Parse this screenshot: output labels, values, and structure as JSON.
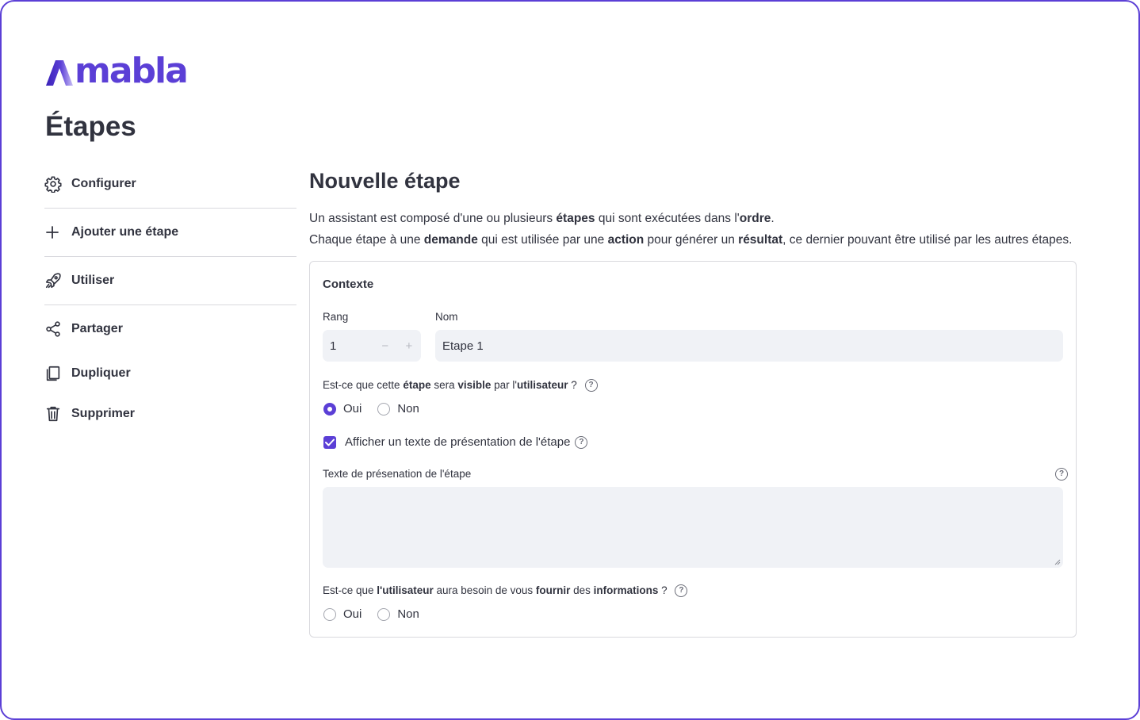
{
  "brand": {
    "name": "mabla",
    "color": "#5b3fd6"
  },
  "page": {
    "title": "Étapes"
  },
  "sidebar": {
    "items": [
      {
        "label": "Configurer",
        "icon": "gear-icon"
      },
      {
        "label": "Ajouter une étape",
        "icon": "plus-icon"
      },
      {
        "label": "Utiliser",
        "icon": "rocket-icon"
      },
      {
        "label": "Partager",
        "icon": "share-icon"
      },
      {
        "label": "Dupliquer",
        "icon": "copy-icon"
      },
      {
        "label": "Supprimer",
        "icon": "trash-icon"
      }
    ]
  },
  "main": {
    "title": "Nouvelle étape",
    "intro": {
      "line1": [
        "Un assistant est composé d'une ou plusieurs ",
        "étapes",
        " qui sont exécutées dans l'",
        "ordre",
        "."
      ],
      "line2": [
        "Chaque étape à une ",
        "demande",
        " qui est utilisée par une ",
        "action",
        " pour générer un ",
        "résultat",
        ", ce dernier pouvant être utilisé par les autres étapes."
      ]
    }
  },
  "form": {
    "section_title": "Contexte",
    "rang": {
      "label": "Rang",
      "value": "1",
      "minus": "−",
      "plus": "+"
    },
    "nom": {
      "label": "Nom",
      "value": "Etape 1"
    },
    "visible": {
      "question": [
        "Est-ce que cette ",
        "étape",
        " sera ",
        "visible",
        " par l'",
        "utilisateur",
        " ?"
      ],
      "options": [
        "Oui",
        "Non"
      ],
      "selected": "Oui"
    },
    "show_presentation": {
      "label": "Afficher un texte de présentation de l'étape",
      "checked": true
    },
    "presentation": {
      "label": "Texte de présenation de l'étape",
      "value": ""
    },
    "needs_info": {
      "question": [
        "Est-ce que ",
        "l'utilisateur",
        " aura besoin de vous ",
        "fournir",
        " des ",
        "informations",
        " ?"
      ],
      "options": [
        "Oui",
        "Non"
      ],
      "selected": null
    }
  }
}
